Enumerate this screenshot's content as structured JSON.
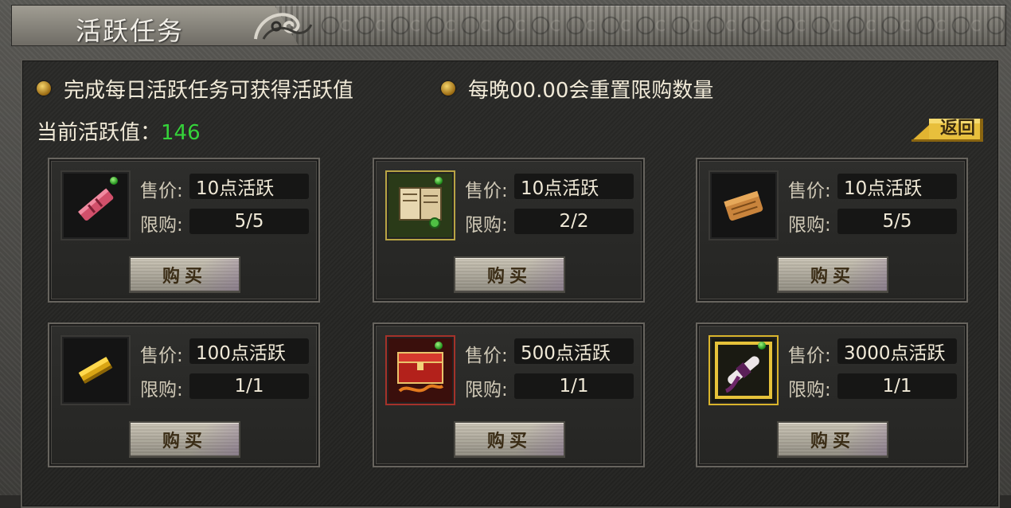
{
  "window": {
    "title": "活跃任务"
  },
  "notices": [
    "完成每日活跃任务可获得活跃值",
    "每晚00.00会重置限购数量"
  ],
  "current": {
    "label": "当前活跃值：",
    "value": "146"
  },
  "back_label": "返回",
  "labels": {
    "price": "售价:",
    "limit": "限购:",
    "buy": "购买"
  },
  "items": [
    {
      "icon": "red-scroll-icon",
      "price": "10点活跃",
      "limit": "5/5"
    },
    {
      "icon": "book-icon",
      "price": "10点活跃",
      "limit": "2/2"
    },
    {
      "icon": "paper-scroll-icon",
      "price": "10点活跃",
      "limit": "5/5"
    },
    {
      "icon": "gold-bar-icon",
      "price": "100点活跃",
      "limit": "1/1"
    },
    {
      "icon": "treasure-chest-icon",
      "price": "500点活跃",
      "limit": "1/1"
    },
    {
      "icon": "ribbon-scroll-icon",
      "price": "3000点活跃",
      "limit": "1/1"
    }
  ],
  "colors": {
    "active_value": "#35d33a",
    "accent_gold": "#e2b431"
  }
}
